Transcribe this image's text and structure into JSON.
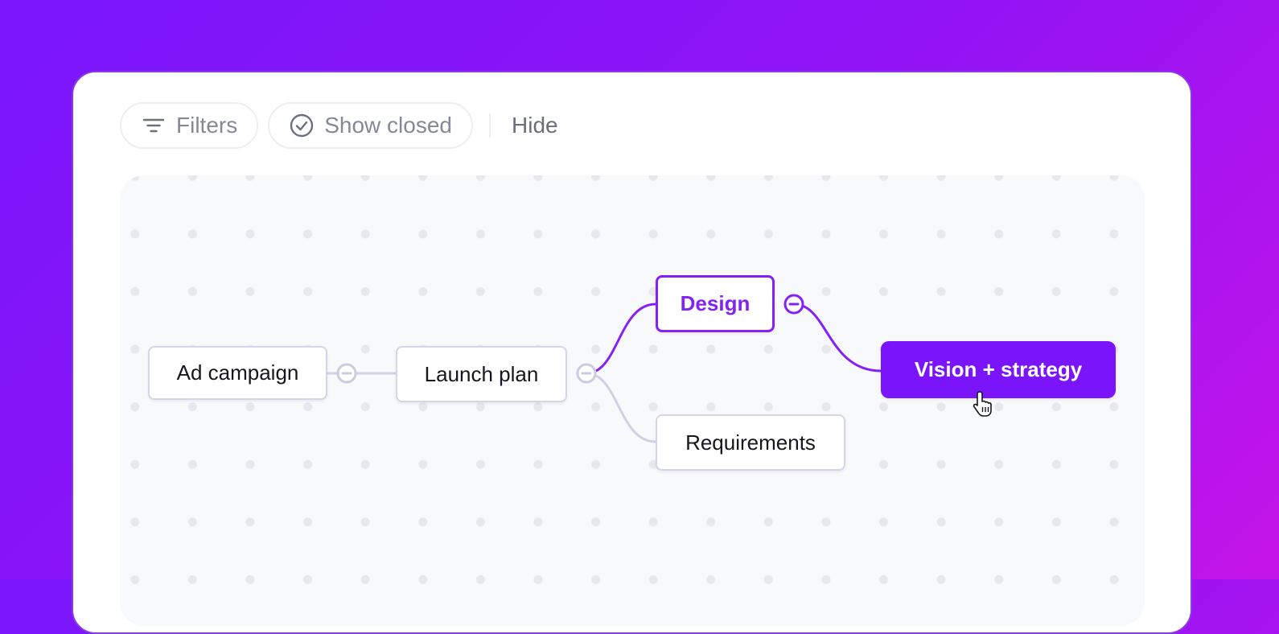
{
  "toolbar": {
    "filters_label": "Filters",
    "show_closed_label": "Show closed",
    "hide_label": "Hide"
  },
  "nodes": {
    "ad_campaign": "Ad campaign",
    "launch_plan": "Launch plan",
    "design": "Design",
    "requirements": "Requirements",
    "vision_strategy": "Vision + strategy"
  },
  "colors": {
    "accent": "#7a15fb",
    "link_inactive": "#d3d0e6",
    "background_gradient": [
      "#7a16fc",
      "#c414e8"
    ]
  },
  "icons": [
    "filter-icon",
    "check-circle-icon",
    "collapse-icon",
    "pointer-cursor-icon"
  ]
}
